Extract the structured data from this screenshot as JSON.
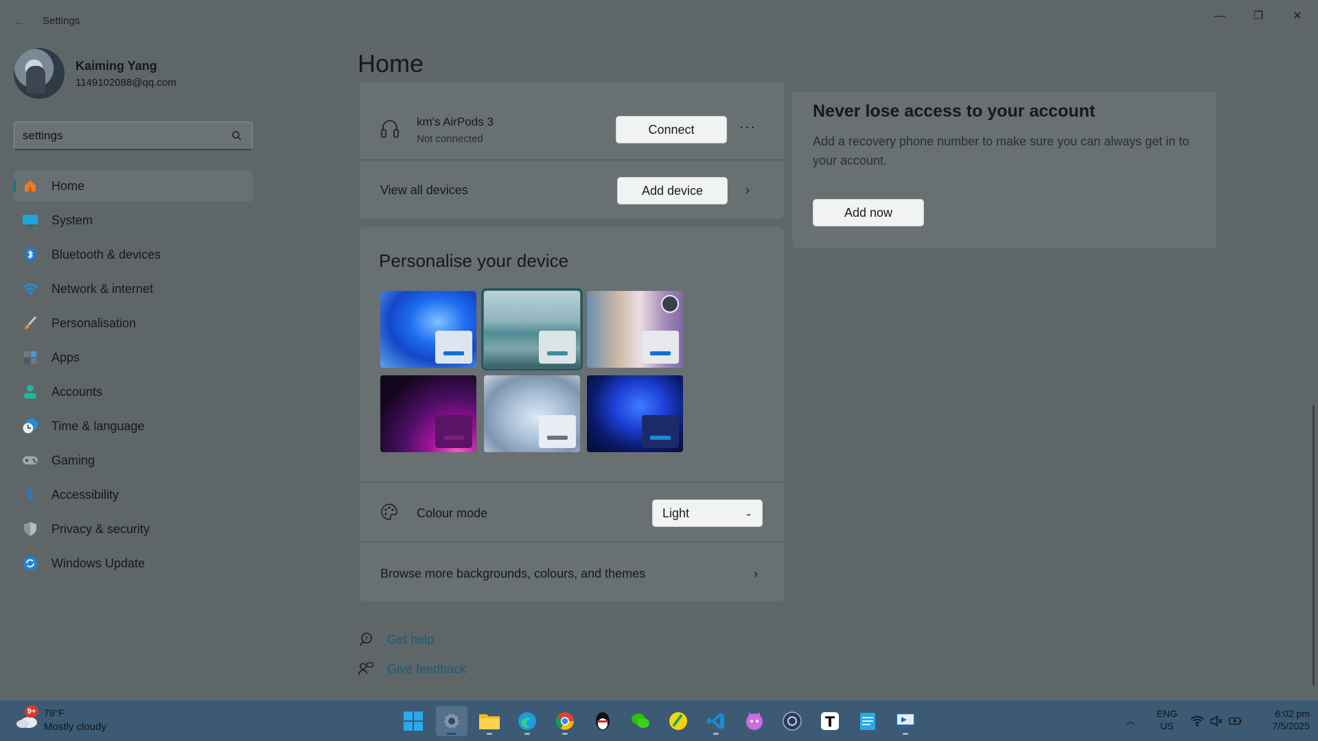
{
  "window": {
    "title": "Settings",
    "back_glyph": "←",
    "minimize_glyph": "—",
    "restore_glyph": "❐",
    "close_glyph": "✕"
  },
  "profile": {
    "name": "Kaiming Yang",
    "email": "1149102088@qq.com"
  },
  "search": {
    "value": "settings",
    "icon": "search-icon"
  },
  "sidebar": {
    "items": [
      {
        "label": "Home",
        "icon": "home-icon",
        "active": true
      },
      {
        "label": "System",
        "icon": "monitor-icon"
      },
      {
        "label": "Bluetooth & devices",
        "icon": "bluetooth-icon"
      },
      {
        "label": "Network & internet",
        "icon": "wifi-icon"
      },
      {
        "label": "Personalisation",
        "icon": "paintbrush-icon"
      },
      {
        "label": "Apps",
        "icon": "apps-icon"
      },
      {
        "label": "Accounts",
        "icon": "person-icon"
      },
      {
        "label": "Time & language",
        "icon": "clock-globe-icon"
      },
      {
        "label": "Gaming",
        "icon": "gamepad-icon"
      },
      {
        "label": "Accessibility",
        "icon": "accessibility-icon"
      },
      {
        "label": "Privacy & security",
        "icon": "shield-icon"
      },
      {
        "label": "Windows Update",
        "icon": "update-icon"
      }
    ]
  },
  "main": {
    "title": "Home",
    "devices": {
      "device_name": "km's AirPods 3",
      "device_status": "Not connected",
      "connect_label": "Connect",
      "more_label": "···",
      "view_all_label": "View all devices",
      "add_device_label": "Add device"
    },
    "personalise": {
      "title": "Personalise your device",
      "themes": [
        {
          "name": "windows-bloom-light",
          "selected": false
        },
        {
          "name": "glow-lake",
          "selected": true
        },
        {
          "name": "spotlight",
          "selected": false
        },
        {
          "name": "glow",
          "selected": false
        },
        {
          "name": "captured-motion",
          "selected": false
        },
        {
          "name": "windows-bloom-dark",
          "selected": false
        }
      ],
      "colour_mode_label": "Colour mode",
      "colour_mode_value": "Light",
      "browse_label": "Browse more backgrounds, colours, and themes"
    },
    "account": {
      "title": "Never lose access to your account",
      "description": "Add a recovery phone number to make sure you can always get in to your account.",
      "button_label": "Add now"
    },
    "help": {
      "get_help": "Get help",
      "give_feedback": "Give feedback"
    }
  },
  "taskbar": {
    "weather_badge": "9+",
    "weather_temp": "79°F",
    "weather_desc": "Mostly cloudy",
    "apps": [
      "start",
      "settings",
      "file-explorer",
      "edge",
      "chrome",
      "qq",
      "wechat",
      "app-yellow",
      "vscode",
      "app-cat",
      "app-circle",
      "typora",
      "notepad",
      "remote-desktop"
    ],
    "lang_line1": "ENG",
    "lang_line2": "US",
    "time": "6:02 pm",
    "date": "7/5/2025"
  },
  "colors": {
    "background": "#5f6668",
    "card": "#687072",
    "link": "#165d7a",
    "taskbar": "#3d5a74",
    "accent": "#1072cf"
  }
}
